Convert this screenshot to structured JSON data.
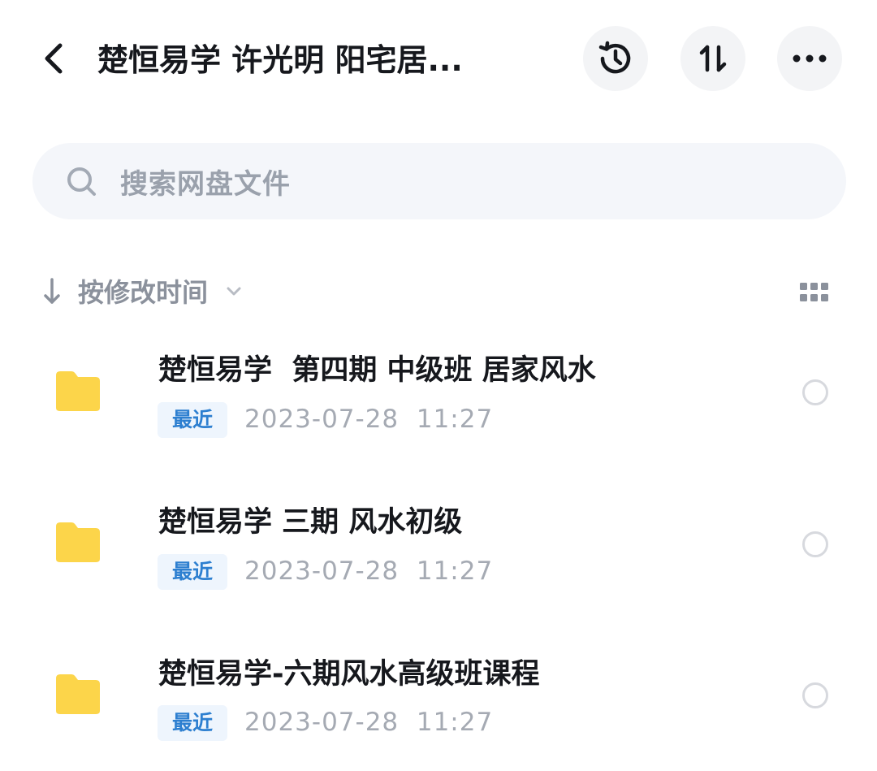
{
  "header": {
    "title": "楚恒易学 许光明 阳宅居...",
    "icons": {
      "back": "chevron-left-icon",
      "history": "history-clock-icon",
      "sort": "sort-arrows-icon",
      "more": "more-dots-icon"
    }
  },
  "search": {
    "placeholder": "搜索网盘文件",
    "icon": "search-icon"
  },
  "sortbar": {
    "label": "按修改时间",
    "icons": {
      "direction": "arrow-down-icon",
      "caret": "chevron-down-icon",
      "view": "grid-view-icon"
    }
  },
  "files": [
    {
      "name": "楚恒易学  第四期 中级班 居家风水",
      "badge": "最近",
      "date": "2023-07-28  11:27",
      "icon": "folder-icon"
    },
    {
      "name": "楚恒易学 三期 风水初级",
      "badge": "最近",
      "date": "2023-07-28  11:27",
      "icon": "folder-icon"
    },
    {
      "name": "楚恒易学-六期风水高级班课程",
      "badge": "最近",
      "date": "2023-07-28  11:27",
      "icon": "folder-icon"
    }
  ],
  "colors": {
    "folder": "#fcd54a",
    "badge_text": "#2d7fd0",
    "badge_bg": "#eef5fd",
    "secondary_text": "#a5aab3"
  }
}
